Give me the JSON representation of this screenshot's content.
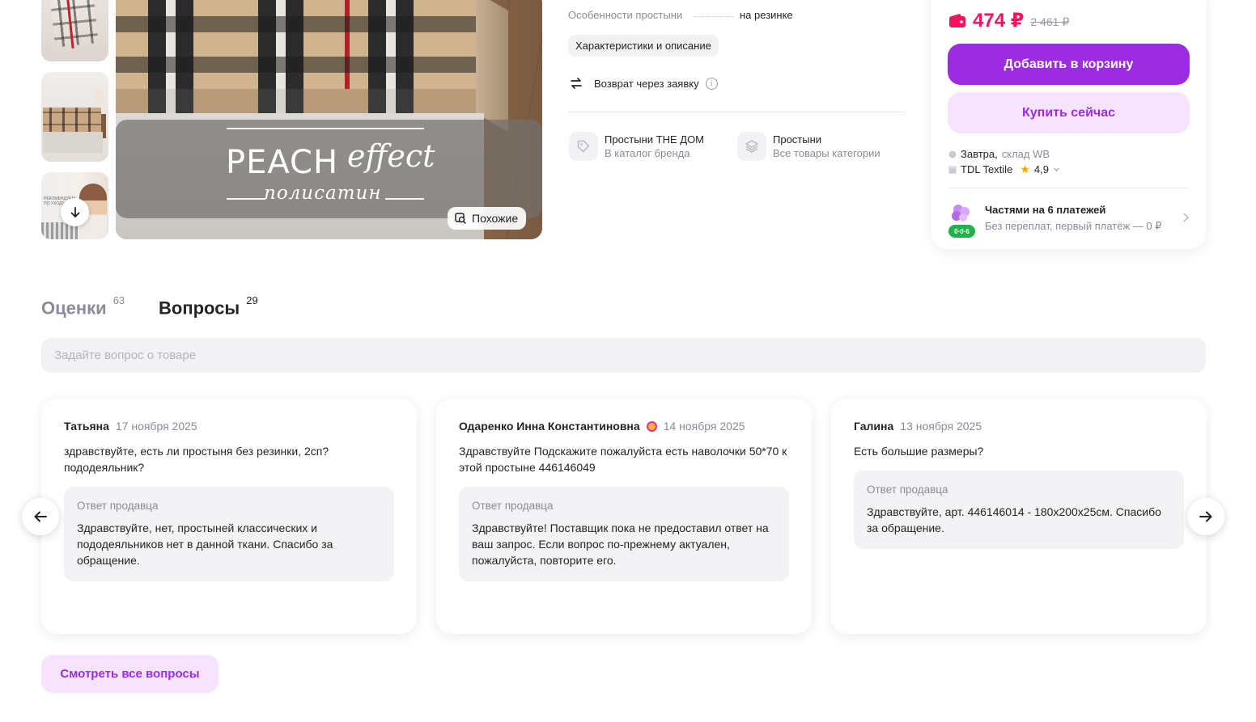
{
  "gallery": {
    "thumb3_text": "РЕКОМЕНДУЕМ ПО УХОДУ",
    "banner_brand": "PEACH",
    "banner_effect": "effect",
    "banner_fabric": "полисатин",
    "similar_label": "Похожие"
  },
  "specs": {
    "feature_label": "Особенности простыни",
    "feature_value": "на резинке",
    "details_chip": "Характеристики и описание",
    "return_label": "Возврат через заявку"
  },
  "categories": [
    {
      "title": "Простыни THE ДОМ",
      "subtitle": "В каталог бренда",
      "icon": "tag-icon"
    },
    {
      "title": "Простыни",
      "subtitle": "Все товары категории",
      "icon": "layers-icon"
    }
  ],
  "buy": {
    "price": "474 ₽",
    "old_price": "2 461 ₽",
    "add_to_cart": "Добавить в корзину",
    "buy_now": "Купить сейчас",
    "delivery_day": "Завтра,",
    "delivery_warehouse": "склад WB",
    "seller": "TDL Textile",
    "rating": "4,9",
    "installments_title": "Частями на 6 платежей",
    "installments_subtitle": "Без переплат, первый платёж — 0 ₽",
    "installments_badge": "0·0·6"
  },
  "tabs": [
    {
      "label": "Оценки",
      "count": "63"
    },
    {
      "label": "Вопросы",
      "count": "29"
    }
  ],
  "ask": {
    "placeholder": "Задайте вопрос о товаре"
  },
  "questions": [
    {
      "author": "Татьяна",
      "date": "17 ноября 2025",
      "text": "здравствуйте, есть ли простыня без резинки, 2сп? пододеяльник?",
      "answer_label": "Ответ продавца",
      "answer": "Здравствуйте, нет, простыней классических и пододеяльников нет в данной ткани. Спасибо за обращение."
    },
    {
      "author": "Одаренко Инна Константиновна",
      "date": "14 ноября 2025",
      "text": "Здравствуйте Подскажите пожалуйста есть наволочки 50*70 к этой простыне 446146049",
      "answer_label": "Ответ продавца",
      "answer": "Здравствуйте! Поставщик пока не предоставил ответ на ваш запрос. Если вопрос по-прежнему актуален, пожалуйста, повторите его."
    },
    {
      "author": "Галина",
      "date": "13 ноября 2025",
      "text": "Есть большие размеры?",
      "answer_label": "Ответ продавца",
      "answer": "Здравствуйте, арт. 446146014 - 180х200х25см. Спасибо за обращение."
    }
  ],
  "all_questions_button": "Смотреть все вопросы",
  "colors": {
    "accent": "#9b2ce0",
    "price": "#f5125e",
    "accent_light": "#f6e3fd"
  }
}
